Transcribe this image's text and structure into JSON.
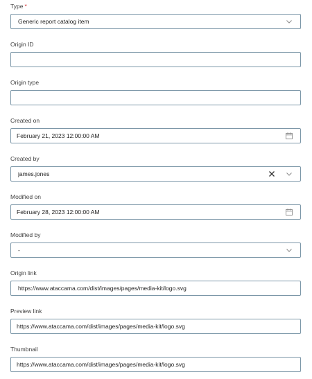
{
  "fields": {
    "type": {
      "label": "Type",
      "required_mark": "*",
      "value": "Generic report catalog item"
    },
    "origin_id": {
      "label": "Origin ID",
      "value": ""
    },
    "origin_type": {
      "label": "Origin type",
      "value": ""
    },
    "created_on": {
      "label": "Created on",
      "value": "February 21, 2023 12:00:00 AM"
    },
    "created_by": {
      "label": "Created by",
      "value": "james.jones"
    },
    "modified_on": {
      "label": "Modified on",
      "value": "February 28, 2023 12:00:00 AM"
    },
    "modified_by": {
      "label": "Modified by",
      "value": "-"
    },
    "origin_link": {
      "label": "Origin link",
      "value": "https://www.ataccama.com/dist/images/pages/media-kit/logo.svg"
    },
    "preview_link": {
      "label": "Preview link",
      "value": "https://www.ataccama.com/dist/images/pages/media-kit/logo.svg"
    },
    "thumbnail": {
      "label": "Thumbnail",
      "value": "https://www.ataccama.com/dist/images/pages/media-kit/logo.svg"
    }
  },
  "icons": {
    "dropdown": "chevron-down-icon",
    "calendar": "calendar-icon",
    "clear": "close-icon"
  },
  "colors": {
    "border": "#7c97a8",
    "required": "#d02b2b"
  }
}
